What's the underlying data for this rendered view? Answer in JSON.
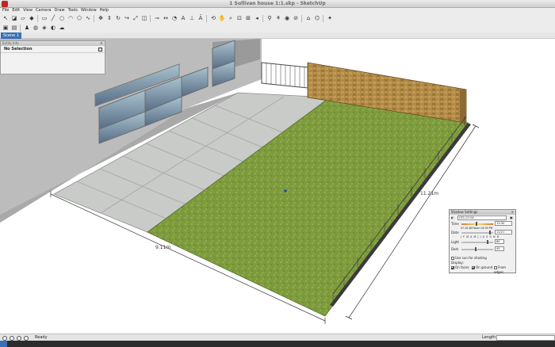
{
  "window": {
    "title": "1 Sullivan house 1:1.skp - SketchUp"
  },
  "menu": [
    "File",
    "Edit",
    "View",
    "Camera",
    "Draw",
    "Tools",
    "Window",
    "Help"
  ],
  "toolbar1": [
    {
      "name": "select-icon",
      "glyph": "↖"
    },
    {
      "name": "make-component-icon",
      "glyph": "◪"
    },
    {
      "name": "eraser-icon",
      "glyph": "▱"
    },
    {
      "name": "paint-bucket-icon",
      "glyph": "◆"
    },
    {
      "name": "sep"
    },
    {
      "name": "rectangle-icon",
      "glyph": "▭"
    },
    {
      "name": "line-icon",
      "glyph": "╱"
    },
    {
      "name": "circle-icon",
      "glyph": "○"
    },
    {
      "name": "arc-icon",
      "glyph": "◠"
    },
    {
      "name": "polygon-icon",
      "glyph": "⬠"
    },
    {
      "name": "freehand-icon",
      "glyph": "∿"
    },
    {
      "name": "sep"
    },
    {
      "name": "move-icon",
      "glyph": "✥"
    },
    {
      "name": "push-pull-icon",
      "glyph": "⇕"
    },
    {
      "name": "rotate-icon",
      "glyph": "↻"
    },
    {
      "name": "follow-me-icon",
      "glyph": "↪"
    },
    {
      "name": "scale-icon",
      "glyph": "⤢"
    },
    {
      "name": "offset-icon",
      "glyph": "◫"
    },
    {
      "name": "sep"
    },
    {
      "name": "tape-measure-icon",
      "glyph": "⊸"
    },
    {
      "name": "dimension-icon",
      "glyph": "↔"
    },
    {
      "name": "protractor-icon",
      "glyph": "◔"
    },
    {
      "name": "text-icon",
      "glyph": "A"
    },
    {
      "name": "axes-icon",
      "glyph": "⊥"
    },
    {
      "name": "3d-text-icon",
      "glyph": "Ā"
    },
    {
      "name": "sep"
    },
    {
      "name": "orbit-icon",
      "glyph": "⟲"
    },
    {
      "name": "pan-icon",
      "glyph": "✋"
    },
    {
      "name": "zoom-icon",
      "glyph": "⌕"
    },
    {
      "name": "zoom-window-icon",
      "glyph": "⊡"
    },
    {
      "name": "zoom-extents-icon",
      "glyph": "⊞"
    },
    {
      "name": "previous-view-icon",
      "glyph": "◂"
    },
    {
      "name": "sep"
    },
    {
      "name": "position-camera-icon",
      "glyph": "⚲"
    },
    {
      "name": "walk-icon",
      "glyph": "⚘"
    },
    {
      "name": "look-around-icon",
      "glyph": "◉"
    },
    {
      "name": "section-plane-icon",
      "glyph": "⊘"
    },
    {
      "name": "sep"
    },
    {
      "name": "get-models-icon",
      "glyph": "⌂"
    },
    {
      "name": "share-model-icon",
      "glyph": "⌬"
    },
    {
      "name": "sep"
    },
    {
      "name": "extension-icon",
      "glyph": "✦"
    }
  ],
  "toolbar2": [
    {
      "name": "folder-icon",
      "glyph": "▣"
    },
    {
      "name": "document-icon",
      "glyph": "▤"
    },
    {
      "name": "sep"
    },
    {
      "name": "components-icon",
      "glyph": "♟"
    },
    {
      "name": "materials-icon",
      "glyph": "◍"
    },
    {
      "name": "styles-icon",
      "glyph": "◈"
    },
    {
      "name": "shadows-icon",
      "glyph": "◐"
    },
    {
      "name": "fog-icon",
      "glyph": "☁"
    }
  ],
  "scene_tab": "Scene 1",
  "entity_info": {
    "header": "Entity Info",
    "selection": "No Selection"
  },
  "dimensions": {
    "width": "9.11m",
    "length": "11.21m"
  },
  "shadow_settings": {
    "title": "Shadow Settings",
    "timezone": "UTC-07:00",
    "time_label": "Time",
    "time_value": "13:30",
    "date_label": "Date",
    "date_value": "11/21",
    "sunrise": "07:16 AM",
    "noon": "Noon",
    "sunset": "04:59 PM",
    "months": "J F M A M J J A S O N D",
    "light_label": "Light",
    "light_value": "80",
    "dark_label": "Dark",
    "dark_value": "45",
    "use_sun": "Use sun for shading",
    "display_label": "Display:",
    "on_faces": "On faces",
    "on_ground": "On ground",
    "from_edges": "From edges"
  },
  "status": {
    "text": "Ready",
    "length_label": "Length"
  },
  "colors": {
    "grass": "#7c9a3c",
    "paving": "#c6c9c6",
    "wall": "#b48a45",
    "scene_tab": "#3a6fb4"
  }
}
